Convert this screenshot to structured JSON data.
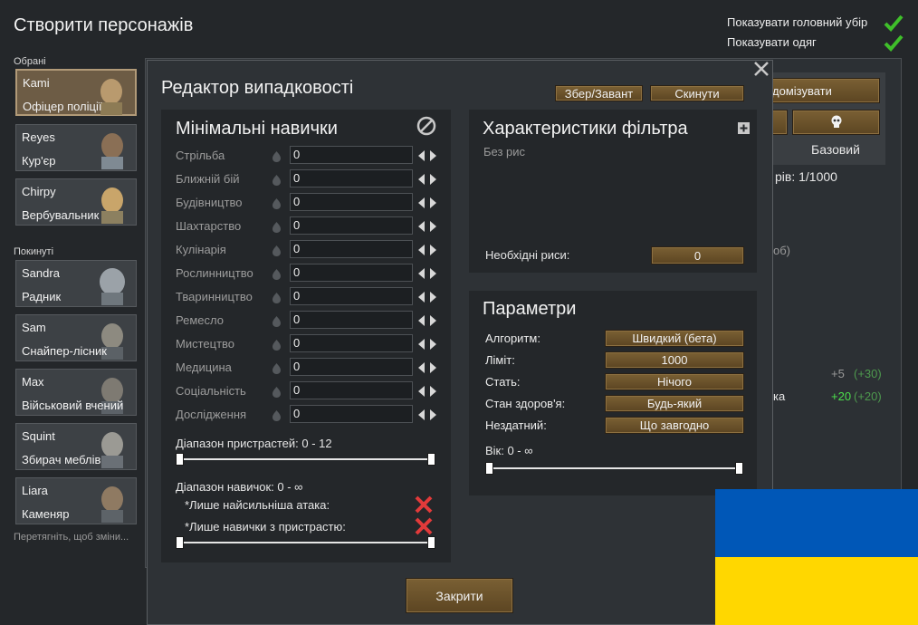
{
  "header": {
    "title": "Створити персонажів",
    "show_headgear": "Показувати головний убір",
    "show_clothing": "Показувати одяг"
  },
  "pawns": {
    "selected_label": "Обрані",
    "left_label": "Покинуті",
    "drag_hint": "Перетягніть, щоб зміни...",
    "selected": [
      {
        "name": "Kami",
        "role": "Офіцер поліції"
      },
      {
        "name": "Reyes",
        "role": "Кур'єр"
      },
      {
        "name": "Chirpy",
        "role": "Вербувальник"
      }
    ],
    "left": [
      {
        "name": "Sandra",
        "role": "Радник"
      },
      {
        "name": "Sam",
        "role": "Снайпер-лісник"
      },
      {
        "name": "Max",
        "role": "Військовий вчений"
      },
      {
        "name": "Squint",
        "role": "Збирач меблів"
      },
      {
        "name": "Liara",
        "role": "Каменяр"
      }
    ]
  },
  "background": {
    "randomize_btn": "домізувати",
    "basic_label": "Базовий",
    "counter": "рів: 1/1000",
    "partial": "об)",
    "partial2": "ка",
    "stat1_a": "+5",
    "stat1_b": "(+30)",
    "stat2_a": "+20",
    "stat2_b": "(+20)"
  },
  "dialog": {
    "title": "Редактор випадковості",
    "save_load": "Збер/Завант",
    "reset": "Скинути",
    "close": "Закрити",
    "skills": {
      "title": "Мінімальні навички",
      "items": [
        {
          "label": "Стрільба",
          "value": "0"
        },
        {
          "label": "Ближній бій",
          "value": "0"
        },
        {
          "label": "Будівництво",
          "value": "0"
        },
        {
          "label": "Шахтарство",
          "value": "0"
        },
        {
          "label": "Кулінарія",
          "value": "0"
        },
        {
          "label": "Рослинництво",
          "value": "0"
        },
        {
          "label": "Тваринництво",
          "value": "0"
        },
        {
          "label": "Ремесло",
          "value": "0"
        },
        {
          "label": "Мистецтво",
          "value": "0"
        },
        {
          "label": "Медицина",
          "value": "0"
        },
        {
          "label": "Соціальність",
          "value": "0"
        },
        {
          "label": "Дослідження",
          "value": "0"
        }
      ],
      "passion_range": "Діапазон пристрастей: 0 - 12",
      "skill_range": "Діапазон навичок: 0 - ∞",
      "only_strongest": "*Лише найсильніша атака:",
      "only_passion": "*Лише навички з пристрастю:"
    },
    "traits": {
      "title": "Характеристики фільтра",
      "empty": "Без рис",
      "required_label": "Необхідні риси:",
      "required_value": "0"
    },
    "params": {
      "title": "Параметри",
      "rows": [
        {
          "label": "Алгоритм:",
          "value": "Швидкий (бета)"
        },
        {
          "label": "Ліміт:",
          "value": "1000"
        },
        {
          "label": "Стать:",
          "value": "Нічого"
        },
        {
          "label": "Стан здоров'я:",
          "value": "Будь-який"
        },
        {
          "label": "Нездатний:",
          "value": "Що завгодно"
        }
      ],
      "age": "Вік: 0 - ∞"
    }
  },
  "colors": {
    "flag_blue": "#0057b7",
    "flag_yellow": "#ffd700",
    "check_green": "#3fbf2a",
    "cross_red": "#e23a3a"
  }
}
